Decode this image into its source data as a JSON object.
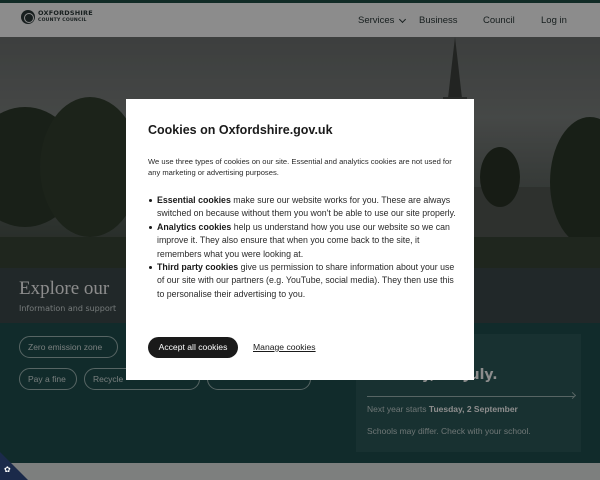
{
  "header": {
    "logo_line1": "OXFORDSHIRE",
    "logo_line2": "COUNTY COUNCIL",
    "nav": {
      "services": "Services",
      "business": "Business",
      "council": "Council",
      "login": "Log in"
    }
  },
  "band": {
    "title": "Explore our",
    "subtitle": "Information and support"
  },
  "quick_links": {
    "zero_emission": "Zero emission zone",
    "pay_fine": "Pay a fine",
    "recycle": "Recycle",
    "apply": ""
  },
  "term_card": {
    "date": "Tuesday, 22 July.",
    "next_prefix": "Next year starts ",
    "next_date": "Tuesday, 2 September",
    "note": "Schools may differ. Check with your school."
  },
  "cookie_modal": {
    "title": "Cookies on Oxfordshire.gov.uk",
    "intro": "We use three types of cookies on our site. Essential and analytics cookies are not used for any marketing or advertising purposes.",
    "items": [
      {
        "term": "Essential cookies",
        "text": " make sure our website works for you. These are always switched on because without them you won't be able to use our site properly."
      },
      {
        "term": "Analytics cookies",
        "text": " help us understand how you use our website so we can improve it. They also ensure that when you come back to the site, it remembers what you were looking at."
      },
      {
        "term": "Third party cookies",
        "text": " give us permission to share information about your use of our site with our partners (e.g. YouTube, social media). They then use this to personalise their advertising to you."
      }
    ],
    "accept_label": "Accept all cookies",
    "manage_label": "Manage cookies"
  },
  "colors": {
    "brand_green": "#1f4f45",
    "overlay_dark": "#1f4f4f",
    "button_black": "#1a1a1a"
  }
}
